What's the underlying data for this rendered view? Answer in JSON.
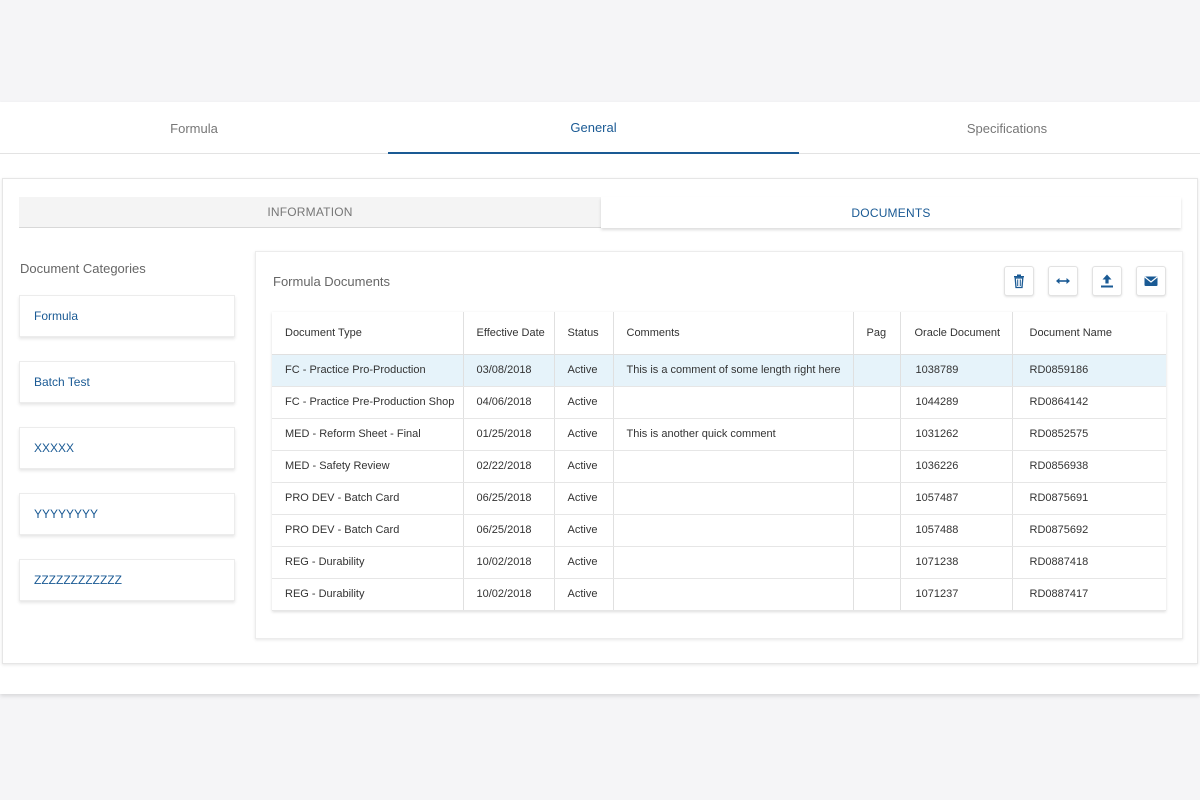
{
  "top_tabs": [
    {
      "label": "Formula",
      "active": false
    },
    {
      "label": "General",
      "active": true
    },
    {
      "label": "Specifications",
      "active": false
    }
  ],
  "sub_tabs": [
    {
      "label": "INFORMATION",
      "active": false
    },
    {
      "label": "DOCUMENTS",
      "active": true
    }
  ],
  "categories": {
    "title": "Document Categories",
    "items": [
      "Formula",
      "Batch Test",
      "XXXXX",
      "YYYYYYYY",
      "ZZZZZZZZZZZZ"
    ]
  },
  "documents": {
    "title": "Formula Documents",
    "toolbar": {
      "delete_icon": "trash-icon",
      "expand_icon": "horizontal-arrows-icon",
      "upload_icon": "upload-icon",
      "email_icon": "envelope-icon"
    },
    "columns": [
      "Document Type",
      "Effective Date",
      "Status",
      "Comments",
      "Pag",
      "Oracle Document",
      "Document Name"
    ],
    "rows": [
      [
        "FC - Practice Pro-Production",
        "03/08/2018",
        "Active",
        "This is a comment of some length right here",
        "",
        "1038789",
        "RD0859186"
      ],
      [
        "FC - Practice Pre-Production Shop",
        "04/06/2018",
        "Active",
        "",
        "",
        "1044289",
        "RD0864142"
      ],
      [
        "MED - Reform Sheet - Final",
        "01/25/2018",
        "Active",
        "This is another quick comment",
        "",
        "1031262",
        "RD0852575"
      ],
      [
        "MED - Safety Review",
        "02/22/2018",
        "Active",
        "",
        "",
        "1036226",
        "RD0856938"
      ],
      [
        "PRO DEV - Batch Card",
        "06/25/2018",
        "Active",
        "",
        "",
        "1057487",
        "RD0875691"
      ],
      [
        "PRO DEV - Batch Card",
        "06/25/2018",
        "Active",
        "",
        "",
        "1057488",
        "RD0875692"
      ],
      [
        "REG - Durability",
        "10/02/2018",
        "Active",
        "",
        "",
        "1071238",
        "RD0887418"
      ],
      [
        "REG - Durability",
        "10/02/2018",
        "Active",
        "",
        "",
        "1071237",
        "RD0887417"
      ]
    ],
    "selected_row": 0
  },
  "colors": {
    "accent": "#1a5a94",
    "selected_row": "#e6f3fa",
    "page_bg": "#f5f5f7"
  }
}
